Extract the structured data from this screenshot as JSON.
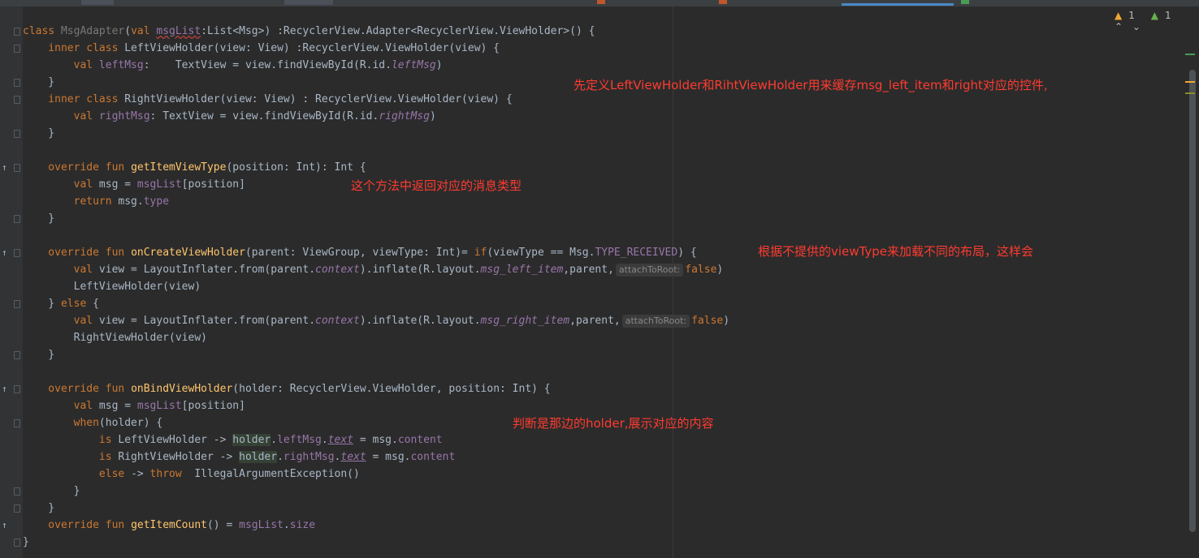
{
  "status": {
    "warnings": "1",
    "ok": "1"
  },
  "annotations": {
    "a1": "先定义LeftViewHolder和RihtViewHolder用来缓存msg_left_item和right对应的控件,",
    "a2": "这个方法中返回对应的消息类型",
    "a3": "根据不提供的viewType来加载不同的布局，这样会",
    "a4": "判断是那边的holder,展示对应的内容"
  },
  "code": {
    "l1a": "class ",
    "l1b": "MsgAdapter",
    "l1c": "(",
    "l1d": "val ",
    "l1e": "msgList",
    "l1f": ":List<Msg>) :RecyclerView.Adapter<RecyclerView.ViewHolder>() {",
    "l2a": "    inner class ",
    "l2b": "LeftViewHolder(view: View) :RecyclerView.ViewHolder(view) {",
    "l3a": "        val ",
    "l3b": "leftMsg",
    "l3c": ":    TextView = view.findViewById(R.id.",
    "l3d": "leftMsg",
    "l3e": ")",
    "l4": "    }",
    "l5a": "    inner class ",
    "l5b": "RightViewHolder(view: View) : RecyclerView.ViewHolder(view) {",
    "l6a": "        val ",
    "l6b": "rightMsg",
    "l6c": ": TextView = view.findViewById(R.id.",
    "l6d": "rightMsg",
    "l6e": ")",
    "l7": "    }",
    "l8": "",
    "l9a": "    override fun ",
    "l9b": "getItemViewType",
    "l9c": "(position: Int): Int {",
    "l10a": "        val ",
    "l10b": "msg = ",
    "l10c": "msgList",
    "l10d": "[position]",
    "l11a": "        return ",
    "l11b": "msg.",
    "l11c": "type",
    "l12": "    }",
    "l13": "",
    "l14a": "    override fun ",
    "l14b": "onCreateViewHolder",
    "l14c": "(parent: ViewGroup, viewType: Int)= ",
    "l14d": "if",
    "l14e": "(viewType == Msg.",
    "l14f": "TYPE_RECEIVED",
    "l14g": ") {",
    "l15a": "        val ",
    "l15b": "view = LayoutInflater.from(parent.",
    "l15c": "context",
    "l15d": ").inflate(R.layout.",
    "l15e": "msg_left_item",
    "l15f": ",parent,",
    "l15hint": "attachToRoot:",
    "l15g": "false",
    "l15h": ")",
    "l16": "        LeftViewHolder(view)",
    "l17a": "    } ",
    "l17b": "else",
    "l17c": " {",
    "l18a": "        val ",
    "l18b": "view = LayoutInflater.from(parent.",
    "l18c": "context",
    "l18d": ").inflate(R.layout.",
    "l18e": "msg_right_item",
    "l18f": ",parent,",
    "l18hint": "attachToRoot:",
    "l18g": "false",
    "l18h": ")",
    "l19": "        RightViewHolder(view)",
    "l20": "    }",
    "l21": "",
    "l22a": "    override fun ",
    "l22b": "onBindViewHolder",
    "l22c": "(holder: RecyclerView.ViewHolder, position: Int) {",
    "l23a": "        val ",
    "l23b": "msg = ",
    "l23c": "msgList",
    "l23d": "[position]",
    "l24a": "        when",
    "l24b": "(holder) {",
    "l25a": "            is ",
    "l25b": "LeftViewHolder -> ",
    "l25c": "holder",
    "l25d": ".",
    "l25e": "leftMsg",
    "l25f": ".",
    "l25g": "text",
    "l25h": " = msg.",
    "l25i": "content",
    "l26a": "            is ",
    "l26b": "RightViewHolder -> ",
    "l26c": "holder",
    "l26d": ".",
    "l26e": "rightMsg",
    "l26f": ".",
    "l26g": "text",
    "l26h": " = msg.",
    "l26i": "content",
    "l27a": "            else ",
    "l27b": "-> ",
    "l27c": "throw ",
    "l27d": " IllegalArgumentException()",
    "l28": "        }",
    "l29": "    }",
    "l30a": "    override fun ",
    "l30b": "getItemCount",
    "l30c": "() = ",
    "l30d": "msgList",
    "l30e": ".",
    "l30f": "size",
    "l31": "}"
  }
}
